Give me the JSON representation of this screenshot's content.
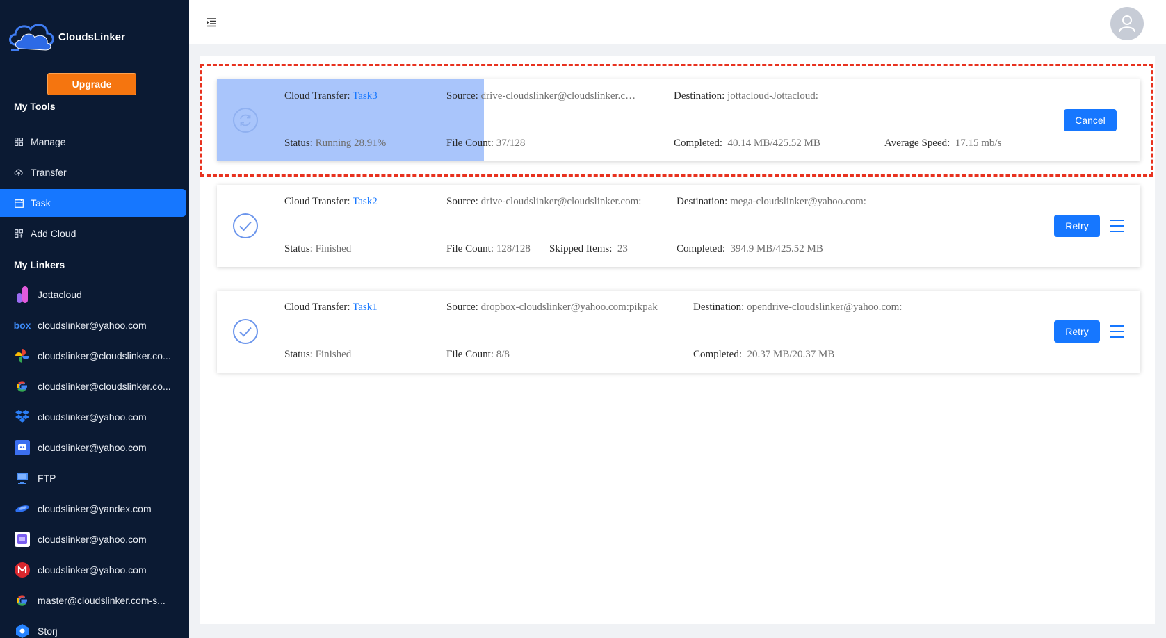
{
  "brand": {
    "name": "CloudsLinker"
  },
  "sidebar": {
    "upgrade_label": "Upgrade",
    "tools_title": "My Tools",
    "tools": [
      {
        "label": "Manage",
        "icon": "grid-icon"
      },
      {
        "label": "Transfer",
        "icon": "cloud-transfer-icon"
      },
      {
        "label": "Task",
        "icon": "calendar-icon",
        "active": true
      },
      {
        "label": "Add Cloud",
        "icon": "add-grid-icon"
      }
    ],
    "linkers_title": "My Linkers",
    "linkers": [
      {
        "label": "Jottacloud",
        "icon": "jottacloud-icon"
      },
      {
        "label": "cloudslinker@yahoo.com",
        "icon": "box-icon"
      },
      {
        "label": "cloudslinker@cloudslinker.co...",
        "icon": "google-photos-icon"
      },
      {
        "label": "cloudslinker@cloudslinker.co...",
        "icon": "google-icon"
      },
      {
        "label": "cloudslinker@yahoo.com",
        "icon": "dropbox-icon"
      },
      {
        "label": "cloudslinker@yahoo.com",
        "icon": "blue-square-icon"
      },
      {
        "label": "FTP",
        "icon": "ftp-icon"
      },
      {
        "label": "cloudslinker@yandex.com",
        "icon": "yandex-icon"
      },
      {
        "label": "cloudslinker@yahoo.com",
        "icon": "purple-square-icon"
      },
      {
        "label": "cloudslinker@yahoo.com",
        "icon": "mega-icon"
      },
      {
        "label": "master@cloudslinker.com-s...",
        "icon": "google-icon"
      },
      {
        "label": "Storj",
        "icon": "storj-icon"
      }
    ]
  },
  "tasks": [
    {
      "name_label": "Cloud Transfer:",
      "name": "Task3",
      "source_label": "Source:",
      "source": "drive-cloudslinker@cloudslinker.c…",
      "destination_label": "Destination:",
      "destination": "jottacloud-Jottacloud:",
      "status_label": "Status:",
      "status": "Running 28.91%",
      "progress": 0.2891,
      "filecount_label": "File Count:",
      "filecount": "37/128",
      "completed_label": "Completed:",
      "completed": "40.14 MB/425.52 MB",
      "speed_label": "Average Speed:",
      "speed": "17.15 mb/s",
      "action_label": "Cancel",
      "status_icon": "sync-icon"
    },
    {
      "name_label": "Cloud Transfer:",
      "name": "Task2",
      "source_label": "Source:",
      "source": "drive-cloudslinker@cloudslinker.com:",
      "destination_label": "Destination:",
      "destination": "mega-cloudslinker@yahoo.com:",
      "status_label": "Status:",
      "status": "Finished",
      "filecount_label": "File Count:",
      "filecount": "128/128",
      "skipped_label": "Skipped Items:",
      "skipped": "23",
      "completed_label": "Completed:",
      "completed": "394.9 MB/425.52 MB",
      "action_label": "Retry",
      "status_icon": "check-circle-icon"
    },
    {
      "name_label": "Cloud Transfer:",
      "name": "Task1",
      "source_label": "Source:",
      "source": "dropbox-cloudslinker@yahoo.com:pikpak",
      "destination_label": "Destination:",
      "destination": "opendrive-cloudslinker@yahoo.com:",
      "status_label": "Status:",
      "status": "Finished",
      "filecount_label": "File Count:",
      "filecount": "8/8",
      "completed_label": "Completed:",
      "completed": "20.37 MB/20.37 MB",
      "action_label": "Retry",
      "status_icon": "check-circle-icon"
    }
  ]
}
